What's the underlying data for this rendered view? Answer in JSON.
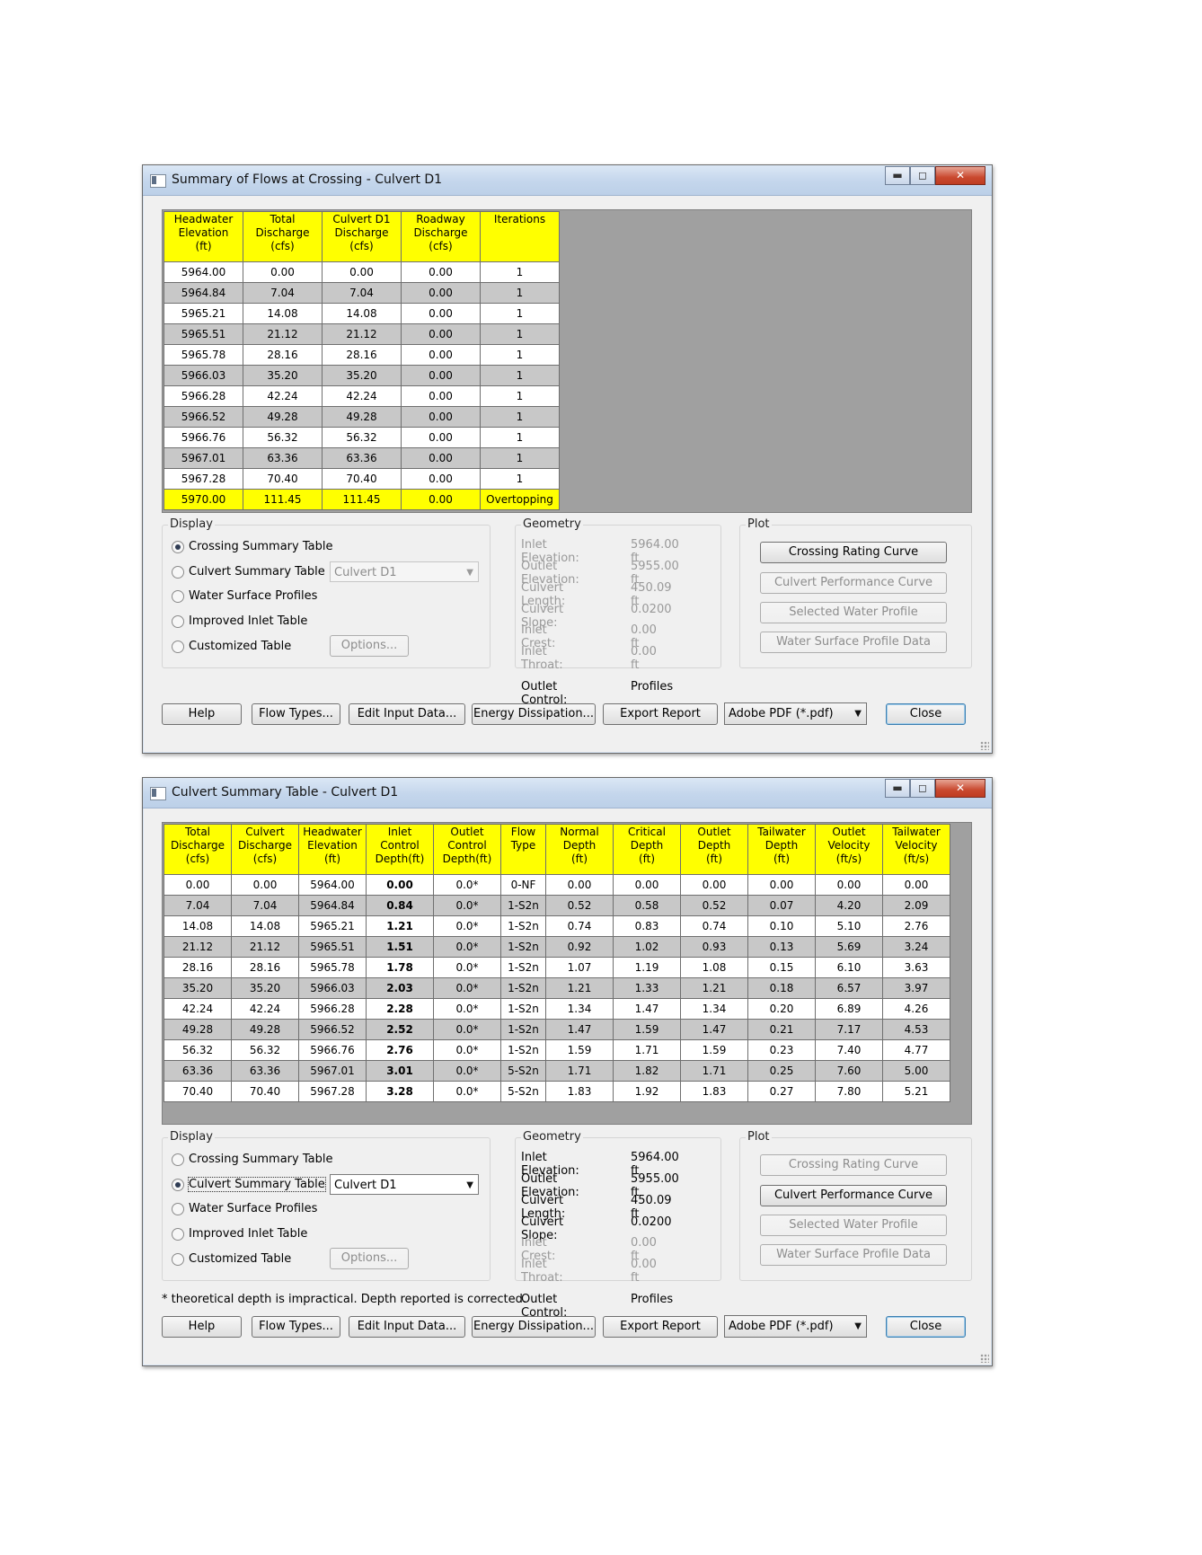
{
  "window1": {
    "title": "Summary of Flows at Crossing - Culvert D1",
    "columns": [
      [
        "Headwater",
        "Elevation",
        "(ft)"
      ],
      [
        "Total",
        "Discharge",
        "(cfs)"
      ],
      [
        "Culvert D1",
        "Discharge",
        "(cfs)"
      ],
      [
        "Roadway",
        "Discharge",
        "(cfs)"
      ],
      [
        "Iterations",
        "",
        ""
      ]
    ],
    "rows": [
      [
        "5964.00",
        "0.00",
        "0.00",
        "0.00",
        "1"
      ],
      [
        "5964.84",
        "7.04",
        "7.04",
        "0.00",
        "1"
      ],
      [
        "5965.21",
        "14.08",
        "14.08",
        "0.00",
        "1"
      ],
      [
        "5965.51",
        "21.12",
        "21.12",
        "0.00",
        "1"
      ],
      [
        "5965.78",
        "28.16",
        "28.16",
        "0.00",
        "1"
      ],
      [
        "5966.03",
        "35.20",
        "35.20",
        "0.00",
        "1"
      ],
      [
        "5966.28",
        "42.24",
        "42.24",
        "0.00",
        "1"
      ],
      [
        "5966.52",
        "49.28",
        "49.28",
        "0.00",
        "1"
      ],
      [
        "5966.76",
        "56.32",
        "56.32",
        "0.00",
        "1"
      ],
      [
        "5967.01",
        "63.36",
        "63.36",
        "0.00",
        "1"
      ],
      [
        "5967.28",
        "70.40",
        "70.40",
        "0.00",
        "1"
      ],
      [
        "5970.00",
        "111.45",
        "111.45",
        "0.00",
        "Overtopping"
      ]
    ],
    "display": {
      "label": "Display",
      "options": [
        "Crossing Summary Table",
        "Culvert Summary Table",
        "Water Surface Profiles",
        "Improved Inlet Table",
        "Customized Table"
      ],
      "selected": 0,
      "culvert_select": "Culvert D1",
      "options_button": "Options..."
    },
    "geometry": {
      "label": "Geometry",
      "rows": [
        {
          "k": "Inlet Elevation:",
          "v": "5964.00 ft"
        },
        {
          "k": "Outlet Elevation:",
          "v": "5955.00 ft"
        },
        {
          "k": "Culvert Length:",
          "v": "450.09 ft"
        },
        {
          "k": "Culvert Slope:",
          "v": "0.0200"
        },
        {
          "k": "Inlet Crest:",
          "v": "0.00 ft"
        },
        {
          "k": "Inlet Throat:",
          "v": "0.00 ft"
        }
      ],
      "outlet_control_label": "Outlet Control:",
      "outlet_control_value": "Profiles"
    },
    "plot": {
      "label": "Plot",
      "buttons": [
        "Crossing Rating Curve",
        "Culvert Performance Curve",
        "Selected Water Profile",
        "Water Surface Profile Data"
      ]
    },
    "footnote": "",
    "bottom": {
      "help": "Help",
      "flow_types": "Flow Types...",
      "edit_input": "Edit Input Data...",
      "energy": "Energy Dissipation...",
      "export": "Export Report",
      "format": "Adobe PDF (*.pdf)",
      "close": "Close"
    }
  },
  "window2": {
    "title": "Culvert Summary Table - Culvert D1",
    "columns": [
      [
        "Total",
        "Discharge",
        "(cfs)"
      ],
      [
        "Culvert",
        "Discharge",
        "(cfs)"
      ],
      [
        "Headwater",
        "Elevation",
        "(ft)"
      ],
      [
        "Inlet",
        "Control",
        "Depth(ft)"
      ],
      [
        "Outlet",
        "Control",
        "Depth(ft)"
      ],
      [
        "Flow",
        "Type",
        ""
      ],
      [
        "Normal",
        "Depth",
        "(ft)"
      ],
      [
        "Critical",
        "Depth",
        "(ft)"
      ],
      [
        "Outlet",
        "Depth",
        "(ft)"
      ],
      [
        "Tailwater",
        "Depth",
        "(ft)"
      ],
      [
        "Outlet",
        "Velocity",
        "(ft/s)"
      ],
      [
        "Tailwater",
        "Velocity",
        "(ft/s)"
      ]
    ],
    "rows": [
      [
        "0.00",
        "0.00",
        "5964.00",
        "0.00",
        "0.0*",
        "0-NF",
        "0.00",
        "0.00",
        "0.00",
        "0.00",
        "0.00",
        "0.00"
      ],
      [
        "7.04",
        "7.04",
        "5964.84",
        "0.84",
        "0.0*",
        "1-S2n",
        "0.52",
        "0.58",
        "0.52",
        "0.07",
        "4.20",
        "2.09"
      ],
      [
        "14.08",
        "14.08",
        "5965.21",
        "1.21",
        "0.0*",
        "1-S2n",
        "0.74",
        "0.83",
        "0.74",
        "0.10",
        "5.10",
        "2.76"
      ],
      [
        "21.12",
        "21.12",
        "5965.51",
        "1.51",
        "0.0*",
        "1-S2n",
        "0.92",
        "1.02",
        "0.93",
        "0.13",
        "5.69",
        "3.24"
      ],
      [
        "28.16",
        "28.16",
        "5965.78",
        "1.78",
        "0.0*",
        "1-S2n",
        "1.07",
        "1.19",
        "1.08",
        "0.15",
        "6.10",
        "3.63"
      ],
      [
        "35.20",
        "35.20",
        "5966.03",
        "2.03",
        "0.0*",
        "1-S2n",
        "1.21",
        "1.33",
        "1.21",
        "0.18",
        "6.57",
        "3.97"
      ],
      [
        "42.24",
        "42.24",
        "5966.28",
        "2.28",
        "0.0*",
        "1-S2n",
        "1.34",
        "1.47",
        "1.34",
        "0.20",
        "6.89",
        "4.26"
      ],
      [
        "49.28",
        "49.28",
        "5966.52",
        "2.52",
        "0.0*",
        "1-S2n",
        "1.47",
        "1.59",
        "1.47",
        "0.21",
        "7.17",
        "4.53"
      ],
      [
        "56.32",
        "56.32",
        "5966.76",
        "2.76",
        "0.0*",
        "1-S2n",
        "1.59",
        "1.71",
        "1.59",
        "0.23",
        "7.40",
        "4.77"
      ],
      [
        "63.36",
        "63.36",
        "5967.01",
        "3.01",
        "0.0*",
        "5-S2n",
        "1.71",
        "1.82",
        "1.71",
        "0.25",
        "7.60",
        "5.00"
      ],
      [
        "70.40",
        "70.40",
        "5967.28",
        "3.28",
        "0.0*",
        "5-S2n",
        "1.83",
        "1.92",
        "1.83",
        "0.27",
        "7.80",
        "5.21"
      ]
    ],
    "display": {
      "label": "Display",
      "options": [
        "Crossing Summary Table",
        "Culvert Summary Table",
        "Water Surface Profiles",
        "Improved Inlet Table",
        "Customized Table"
      ],
      "selected": 1,
      "culvert_select": "Culvert D1",
      "options_button": "Options..."
    },
    "geometry": {
      "label": "Geometry",
      "rows": [
        {
          "k": "Inlet Elevation:",
          "v": "5964.00 ft"
        },
        {
          "k": "Outlet Elevation:",
          "v": "5955.00 ft"
        },
        {
          "k": "Culvert Length:",
          "v": "450.09 ft"
        },
        {
          "k": "Culvert Slope:",
          "v": "0.0200"
        },
        {
          "k": "Inlet Crest:",
          "v": "0.00 ft"
        },
        {
          "k": "Inlet Throat:",
          "v": "0.00 ft"
        }
      ],
      "outlet_control_label": "Outlet Control:",
      "outlet_control_value": "Profiles"
    },
    "plot": {
      "label": "Plot",
      "buttons": [
        "Crossing Rating Curve",
        "Culvert Performance Curve",
        "Selected Water Profile",
        "Water Surface Profile Data"
      ]
    },
    "footnote": "* theoretical depth is impractical.  Depth reported is corrected.",
    "bottom": {
      "help": "Help",
      "flow_types": "Flow Types...",
      "edit_input": "Edit Input Data...",
      "energy": "Energy Dissipation...",
      "export": "Export Report",
      "format": "Adobe PDF (*.pdf)",
      "close": "Close"
    }
  }
}
